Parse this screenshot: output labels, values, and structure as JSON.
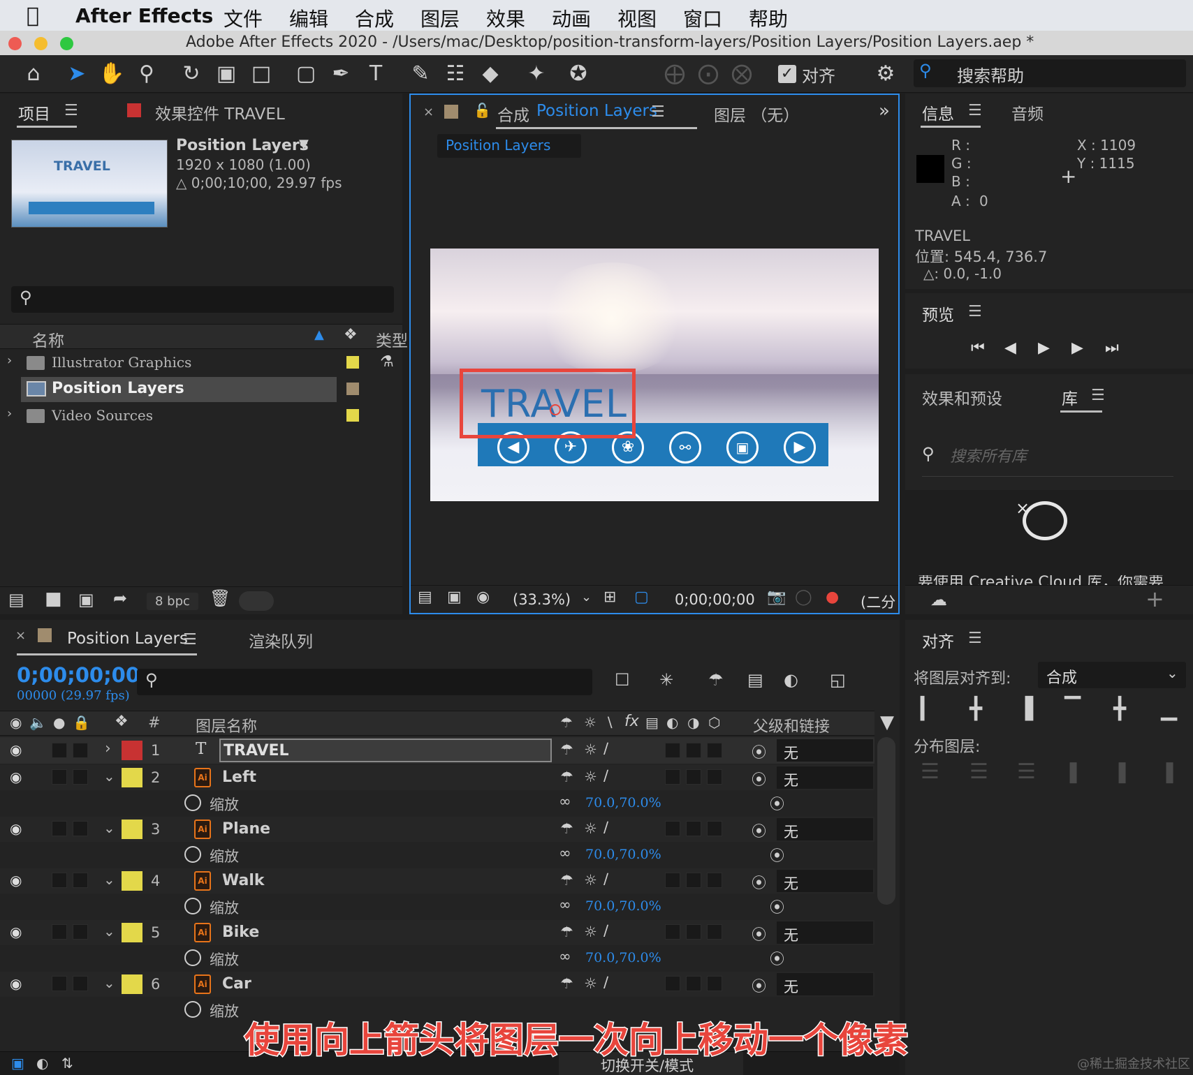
{
  "menubar": {
    "app": "After Effects",
    "items": [
      "文件",
      "编辑",
      "合成",
      "图层",
      "效果",
      "动画",
      "视图",
      "窗口",
      "帮助"
    ]
  },
  "window": {
    "title": "Adobe After Effects 2020 - /Users/mac/Desktop/position-transform-layers/Position Layers/Position Layers.aep *"
  },
  "toolbar": {
    "align_label": "对齐",
    "search_help": "搜索帮助"
  },
  "project": {
    "tab": "项目",
    "effects_tab": "效果控件 TRAVEL",
    "thumb_text": "TRAVEL",
    "comp_name": "Position Layers",
    "comp_size": "1920 x 1080 (1.00)",
    "comp_duration": "△ 0;00;10;00, 29.97 fps",
    "col_name": "名称",
    "col_type": "类型",
    "items": [
      {
        "name": "Illustrator Graphics",
        "type": "folder"
      },
      {
        "name": "Position Layers",
        "type": "comp"
      },
      {
        "name": "Video Sources",
        "type": "folder"
      }
    ],
    "bpc": "8 bpc"
  },
  "composition": {
    "tab_prefix": "合成",
    "tab_name": "Position Layers",
    "layer_tab": "图层 （无）",
    "breadcrumb": "Position Layers",
    "text": "TRAVEL",
    "zoom": "(33.3%)",
    "timecode": "0;00;00;00",
    "resolution": "(二分"
  },
  "info": {
    "tab": "信息",
    "audio_tab": "音频",
    "r": "R :",
    "g": "G :",
    "b": "B :",
    "a": "A :",
    "a_val": "0",
    "x": "X : 1109",
    "y": "Y : 1115",
    "layer": "TRAVEL",
    "position": "位置: 545.4, 736.7",
    "delta": "△: 0.0, -1.0"
  },
  "preview": {
    "tab": "预览"
  },
  "effects_presets": {
    "tab": "效果和预设",
    "lib_tab": "库",
    "search_placeholder": "搜索所有库",
    "cut_text": "要使用 Creative Cloud 库，你需要"
  },
  "align": {
    "tab": "对齐",
    "align_to_label": "将图层对齐到:",
    "align_to_value": "合成",
    "distribute_label": "分布图层:"
  },
  "timeline": {
    "tab": "Position Layers",
    "render_tab": "渲染队列",
    "timecode": "0;00;00;00",
    "frames": "00000 (29.97 fps)",
    "col_num": "#",
    "col_name": "图层名称",
    "col_parent": "父级和链接",
    "layers": [
      {
        "num": "1",
        "name": "TRAVEL",
        "kind": "text",
        "color": "#c83232",
        "parent": "无"
      },
      {
        "num": "2",
        "name": "Left",
        "kind": "ai",
        "color": "#e3d84a",
        "parent": "无",
        "prop": "缩放",
        "value": "70.0,70.0%"
      },
      {
        "num": "3",
        "name": "Plane",
        "kind": "ai",
        "color": "#e3d84a",
        "parent": "无",
        "prop": "缩放",
        "value": "70.0,70.0%"
      },
      {
        "num": "4",
        "name": "Walk",
        "kind": "ai",
        "color": "#e3d84a",
        "parent": "无",
        "prop": "缩放",
        "value": "70.0,70.0%"
      },
      {
        "num": "5",
        "name": "Bike",
        "kind": "ai",
        "color": "#e3d84a",
        "parent": "无",
        "prop": "缩放",
        "value": "70.0,70.0%"
      },
      {
        "num": "6",
        "name": "Car",
        "kind": "ai",
        "color": "#e3d84a",
        "parent": "无",
        "prop": "缩放",
        "value": ""
      }
    ],
    "bottom_toggle": "切换开关/模式"
  },
  "caption": "使用向上箭头将图层一次向上移动一个像素",
  "watermark": "@稀土掘金技术社区",
  "colors": {
    "accent": "#2d8ceb",
    "selection": "#e8453c",
    "label_yellow": "#e3d84a",
    "label_red": "#c83232"
  }
}
